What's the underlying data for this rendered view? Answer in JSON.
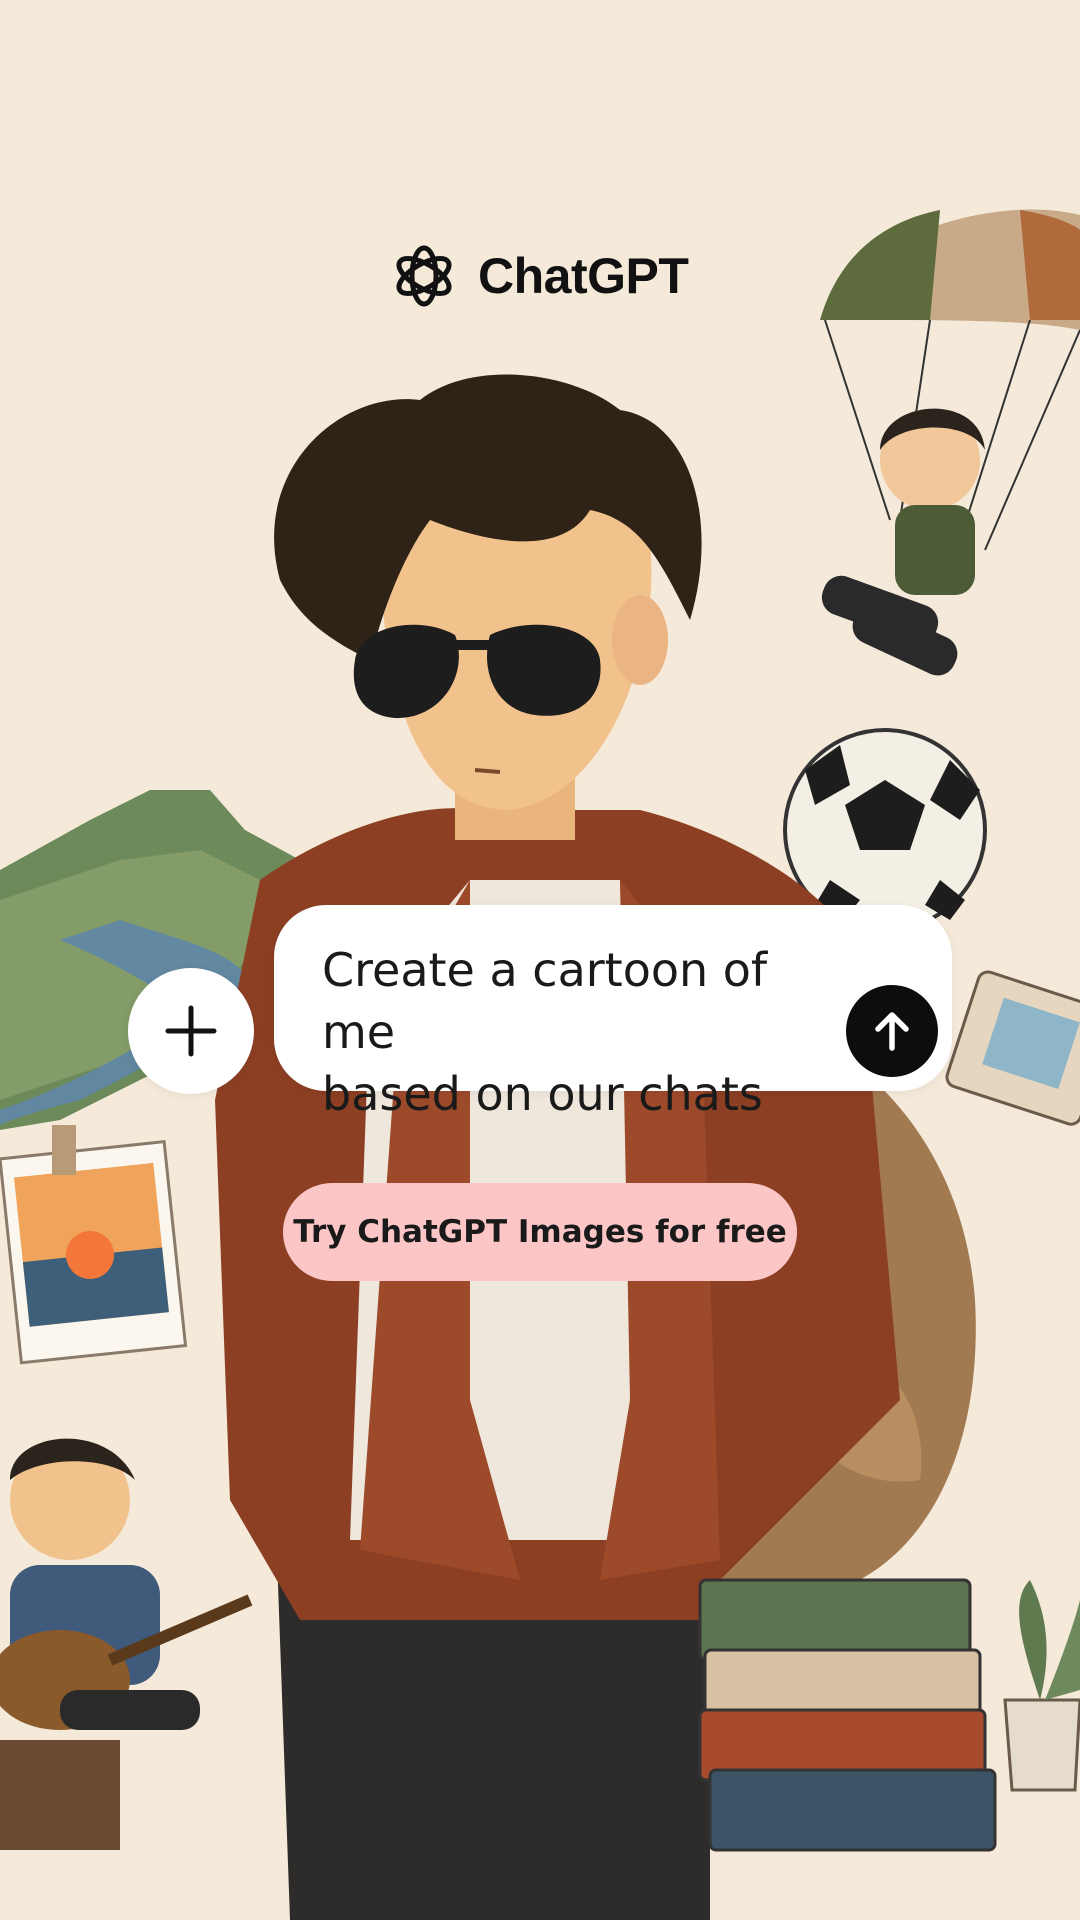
{
  "brand": {
    "name": "ChatGPT"
  },
  "prompt": {
    "line1": "Create a cartoon of me",
    "line2": "based on our chats"
  },
  "cta": {
    "label": "Try ChatGPT Images for free"
  },
  "colors": {
    "background": "#f5e9da",
    "cta": "#fcc6c6",
    "send_button": "#0d0d0d",
    "text": "#1a1a1a"
  },
  "icons": {
    "logo": "openai-logo-icon",
    "send": "arrow-up-icon",
    "add": "plus-icon"
  }
}
